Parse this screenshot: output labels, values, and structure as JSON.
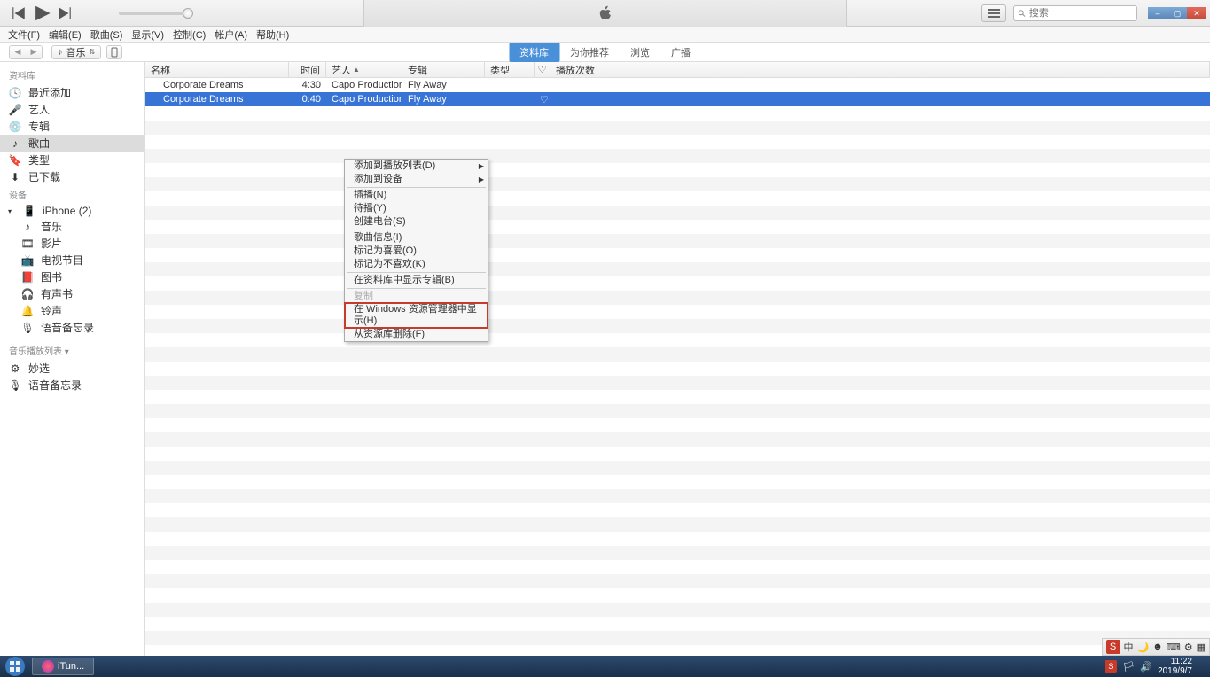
{
  "menubar": [
    "文件(F)",
    "编辑(E)",
    "歌曲(S)",
    "显示(V)",
    "控制(C)",
    "帐户(A)",
    "帮助(H)"
  ],
  "search": {
    "placeholder": "搜索"
  },
  "media_select": "音乐",
  "view_tabs": [
    {
      "label": "资料库",
      "active": true
    },
    {
      "label": "为你推荐",
      "active": false
    },
    {
      "label": "浏览",
      "active": false
    },
    {
      "label": "广播",
      "active": false
    }
  ],
  "sidebar": {
    "sections": [
      {
        "header": "资料库",
        "items": [
          {
            "icon": "clock",
            "label": "最近添加"
          },
          {
            "icon": "mic",
            "label": "艺人"
          },
          {
            "icon": "album",
            "label": "专辑"
          },
          {
            "icon": "note",
            "label": "歌曲",
            "active": true
          },
          {
            "icon": "tag",
            "label": "类型"
          },
          {
            "icon": "download",
            "label": "已下载"
          }
        ]
      },
      {
        "header": "设备",
        "items": [
          {
            "icon": "collapse",
            "label": ""
          },
          {
            "icon": "phone",
            "label": "iPhone (2)"
          },
          {
            "icon": "note",
            "label": "音乐",
            "indent": true
          },
          {
            "icon": "film",
            "label": "影片",
            "indent": true
          },
          {
            "icon": "tv",
            "label": "电视节目",
            "indent": true
          },
          {
            "icon": "book",
            "label": "图书",
            "indent": true
          },
          {
            "icon": "audiobook",
            "label": "有声书",
            "indent": true
          },
          {
            "icon": "bell",
            "label": "铃声",
            "indent": true
          },
          {
            "icon": "voice",
            "label": "语音备忘录",
            "indent": true
          }
        ]
      },
      {
        "header": "音乐播放列表 ▾",
        "items": [
          {
            "icon": "gear",
            "label": "妙选"
          },
          {
            "icon": "voice",
            "label": "语音备忘录"
          }
        ]
      }
    ]
  },
  "columns": {
    "name": "名称",
    "time": "时间",
    "artist": "艺人",
    "album": "专辑",
    "genre": "类型",
    "plays": "播放次数"
  },
  "tracks": [
    {
      "name": "Corporate Dreams",
      "time": "4:30",
      "artist": "Capo Productions",
      "album": "Fly Away",
      "selected": false
    },
    {
      "name": "Corporate Dreams",
      "time": "0:40",
      "artist": "Capo Productions",
      "album": "Fly Away",
      "selected": true,
      "heart": "♡"
    }
  ],
  "context_menu": [
    {
      "label": "添加到播放列表(D)",
      "submenu": true
    },
    {
      "label": "添加到设备",
      "submenu": true
    },
    {
      "sep": true
    },
    {
      "label": "插播(N)"
    },
    {
      "label": "待播(Y)"
    },
    {
      "label": "创建电台(S)"
    },
    {
      "sep": true
    },
    {
      "label": "歌曲信息(I)"
    },
    {
      "label": "标记为喜爱(O)"
    },
    {
      "label": "标记为不喜欢(K)"
    },
    {
      "sep": true
    },
    {
      "label": "在资料库中显示专辑(B)"
    },
    {
      "sep": true
    },
    {
      "label": "复制",
      "disabled": true
    },
    {
      "label": "在 Windows 资源管理器中显示(H)",
      "highlighted": true
    },
    {
      "label": "从资源库删除(F)"
    }
  ],
  "taskbar": {
    "app": "iTun...",
    "clock_time": "11:22",
    "clock_date": "2019/9/7",
    "ime": "中"
  }
}
